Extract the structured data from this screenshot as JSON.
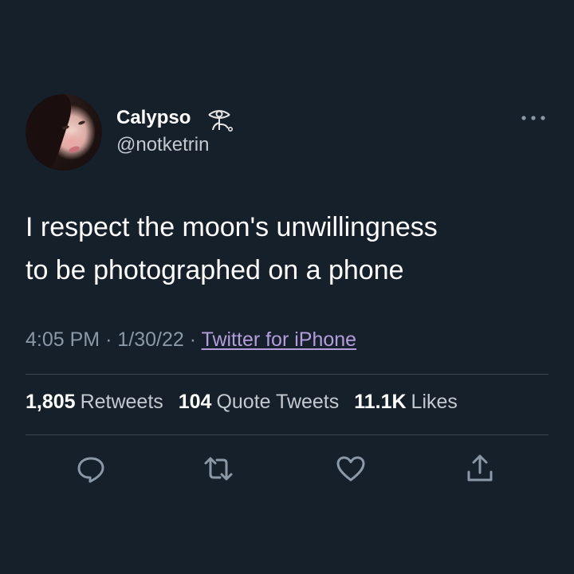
{
  "user": {
    "display_name": "Calypso",
    "handle": "@notketrin",
    "name_emoji": "eye-on-stick-icon"
  },
  "tweet": {
    "text": "I respect the moon's unwillingness\nto be photographed on a phone",
    "time": "4:05 PM",
    "separator": "·",
    "date": "1/30/22",
    "source": "Twitter for iPhone"
  },
  "stats": {
    "retweets_count": "1,805",
    "retweets_label": "Retweets",
    "quotes_count": "104",
    "quotes_label": "Quote Tweets",
    "likes_count": "11.1K",
    "likes_label": "Likes"
  },
  "actions": [
    "reply-icon",
    "retweet-icon",
    "like-icon",
    "share-icon"
  ],
  "colors": {
    "background": "#15202b",
    "primary_text": "#ffffff",
    "secondary_text": "#8b98a5",
    "link": "#b39ddb",
    "divider": "#38444d"
  }
}
